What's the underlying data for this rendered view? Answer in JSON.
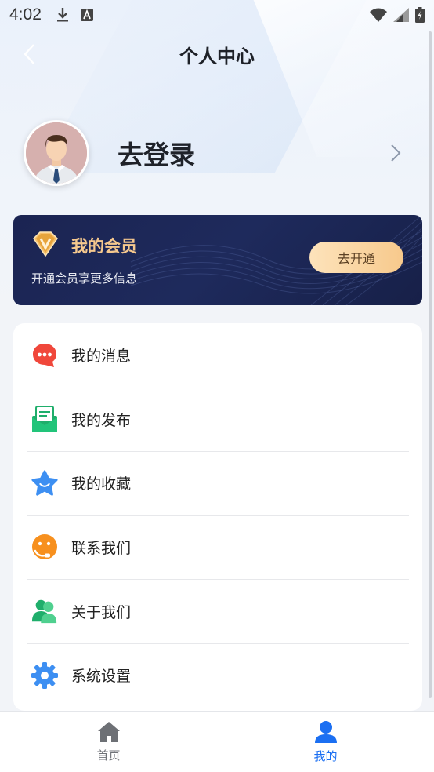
{
  "status_bar": {
    "time": "4:02"
  },
  "header": {
    "title": "个人中心"
  },
  "profile": {
    "login_text": "去登录"
  },
  "vip": {
    "title": "我的会员",
    "subtitle": "开通会员享更多信息",
    "button": "去开通",
    "colors": {
      "card": "#1b2452",
      "title": "#f5c88e",
      "button": "#f7c98c"
    }
  },
  "menu": {
    "items": [
      {
        "label": "我的消息",
        "icon": "message-icon"
      },
      {
        "label": "我的发布",
        "icon": "publish-icon"
      },
      {
        "label": "我的收藏",
        "icon": "favorite-star-icon"
      },
      {
        "label": "联系我们",
        "icon": "contact-icon"
      },
      {
        "label": "关于我们",
        "icon": "about-users-icon"
      },
      {
        "label": "系统设置",
        "icon": "settings-gear-icon"
      }
    ]
  },
  "tabbar": {
    "tabs": [
      {
        "label": "首页",
        "icon": "home-icon",
        "active": false
      },
      {
        "label": "我的",
        "icon": "profile-icon",
        "active": true
      }
    ],
    "active_color": "#1b6ff2"
  }
}
